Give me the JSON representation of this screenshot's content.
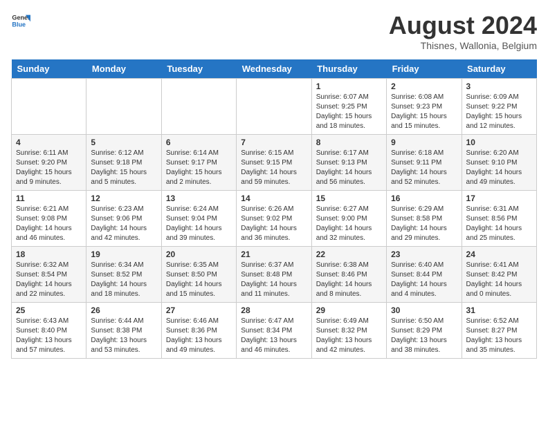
{
  "header": {
    "logo_general": "General",
    "logo_blue": "Blue",
    "title": "August 2024",
    "subtitle": "Thisnes, Wallonia, Belgium"
  },
  "days_of_week": [
    "Sunday",
    "Monday",
    "Tuesday",
    "Wednesday",
    "Thursday",
    "Friday",
    "Saturday"
  ],
  "weeks": [
    [
      {
        "day": "",
        "info": ""
      },
      {
        "day": "",
        "info": ""
      },
      {
        "day": "",
        "info": ""
      },
      {
        "day": "",
        "info": ""
      },
      {
        "day": "1",
        "info": "Sunrise: 6:07 AM\nSunset: 9:25 PM\nDaylight: 15 hours\nand 18 minutes."
      },
      {
        "day": "2",
        "info": "Sunrise: 6:08 AM\nSunset: 9:23 PM\nDaylight: 15 hours\nand 15 minutes."
      },
      {
        "day": "3",
        "info": "Sunrise: 6:09 AM\nSunset: 9:22 PM\nDaylight: 15 hours\nand 12 minutes."
      }
    ],
    [
      {
        "day": "4",
        "info": "Sunrise: 6:11 AM\nSunset: 9:20 PM\nDaylight: 15 hours\nand 9 minutes."
      },
      {
        "day": "5",
        "info": "Sunrise: 6:12 AM\nSunset: 9:18 PM\nDaylight: 15 hours\nand 5 minutes."
      },
      {
        "day": "6",
        "info": "Sunrise: 6:14 AM\nSunset: 9:17 PM\nDaylight: 15 hours\nand 2 minutes."
      },
      {
        "day": "7",
        "info": "Sunrise: 6:15 AM\nSunset: 9:15 PM\nDaylight: 14 hours\nand 59 minutes."
      },
      {
        "day": "8",
        "info": "Sunrise: 6:17 AM\nSunset: 9:13 PM\nDaylight: 14 hours\nand 56 minutes."
      },
      {
        "day": "9",
        "info": "Sunrise: 6:18 AM\nSunset: 9:11 PM\nDaylight: 14 hours\nand 52 minutes."
      },
      {
        "day": "10",
        "info": "Sunrise: 6:20 AM\nSunset: 9:10 PM\nDaylight: 14 hours\nand 49 minutes."
      }
    ],
    [
      {
        "day": "11",
        "info": "Sunrise: 6:21 AM\nSunset: 9:08 PM\nDaylight: 14 hours\nand 46 minutes."
      },
      {
        "day": "12",
        "info": "Sunrise: 6:23 AM\nSunset: 9:06 PM\nDaylight: 14 hours\nand 42 minutes."
      },
      {
        "day": "13",
        "info": "Sunrise: 6:24 AM\nSunset: 9:04 PM\nDaylight: 14 hours\nand 39 minutes."
      },
      {
        "day": "14",
        "info": "Sunrise: 6:26 AM\nSunset: 9:02 PM\nDaylight: 14 hours\nand 36 minutes."
      },
      {
        "day": "15",
        "info": "Sunrise: 6:27 AM\nSunset: 9:00 PM\nDaylight: 14 hours\nand 32 minutes."
      },
      {
        "day": "16",
        "info": "Sunrise: 6:29 AM\nSunset: 8:58 PM\nDaylight: 14 hours\nand 29 minutes."
      },
      {
        "day": "17",
        "info": "Sunrise: 6:31 AM\nSunset: 8:56 PM\nDaylight: 14 hours\nand 25 minutes."
      }
    ],
    [
      {
        "day": "18",
        "info": "Sunrise: 6:32 AM\nSunset: 8:54 PM\nDaylight: 14 hours\nand 22 minutes."
      },
      {
        "day": "19",
        "info": "Sunrise: 6:34 AM\nSunset: 8:52 PM\nDaylight: 14 hours\nand 18 minutes."
      },
      {
        "day": "20",
        "info": "Sunrise: 6:35 AM\nSunset: 8:50 PM\nDaylight: 14 hours\nand 15 minutes."
      },
      {
        "day": "21",
        "info": "Sunrise: 6:37 AM\nSunset: 8:48 PM\nDaylight: 14 hours\nand 11 minutes."
      },
      {
        "day": "22",
        "info": "Sunrise: 6:38 AM\nSunset: 8:46 PM\nDaylight: 14 hours\nand 8 minutes."
      },
      {
        "day": "23",
        "info": "Sunrise: 6:40 AM\nSunset: 8:44 PM\nDaylight: 14 hours\nand 4 minutes."
      },
      {
        "day": "24",
        "info": "Sunrise: 6:41 AM\nSunset: 8:42 PM\nDaylight: 14 hours\nand 0 minutes."
      }
    ],
    [
      {
        "day": "25",
        "info": "Sunrise: 6:43 AM\nSunset: 8:40 PM\nDaylight: 13 hours\nand 57 minutes."
      },
      {
        "day": "26",
        "info": "Sunrise: 6:44 AM\nSunset: 8:38 PM\nDaylight: 13 hours\nand 53 minutes."
      },
      {
        "day": "27",
        "info": "Sunrise: 6:46 AM\nSunset: 8:36 PM\nDaylight: 13 hours\nand 49 minutes."
      },
      {
        "day": "28",
        "info": "Sunrise: 6:47 AM\nSunset: 8:34 PM\nDaylight: 13 hours\nand 46 minutes."
      },
      {
        "day": "29",
        "info": "Sunrise: 6:49 AM\nSunset: 8:32 PM\nDaylight: 13 hours\nand 42 minutes."
      },
      {
        "day": "30",
        "info": "Sunrise: 6:50 AM\nSunset: 8:29 PM\nDaylight: 13 hours\nand 38 minutes."
      },
      {
        "day": "31",
        "info": "Sunrise: 6:52 AM\nSunset: 8:27 PM\nDaylight: 13 hours\nand 35 minutes."
      }
    ]
  ]
}
